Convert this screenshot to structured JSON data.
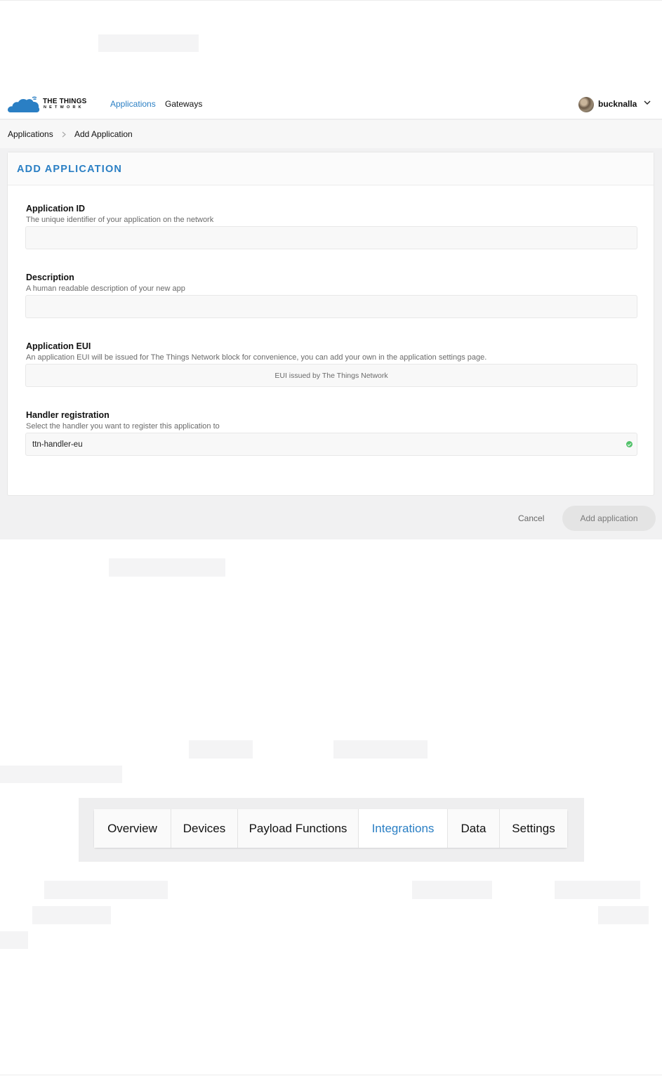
{
  "topbar": {
    "logo_title": "THE THINGS",
    "logo_subtitle": "NETWORK",
    "nav": [
      {
        "label": "Applications",
        "active": true
      },
      {
        "label": "Gateways",
        "active": false
      }
    ],
    "username": "bucknalla"
  },
  "breadcrumb": {
    "items": [
      "Applications",
      "Add Application"
    ]
  },
  "form": {
    "title": "ADD APPLICATION",
    "fields": [
      {
        "label": "Application ID",
        "description": "The unique identifier of your application on the network",
        "value": "",
        "placeholder": ""
      },
      {
        "label": "Description",
        "description": "A human readable description of your new app",
        "value": "",
        "placeholder": ""
      },
      {
        "label": "Application EUI",
        "description": "An application EUI will be issued for The Things Network block for convenience, you can add your own in the application settings page.",
        "value": "",
        "placeholder": "EUI issued by The Things Network"
      },
      {
        "label": "Handler registration",
        "description": "Select the handler you want to register this application to",
        "value": "ttn-handler-eu",
        "placeholder": ""
      }
    ],
    "cancel_label": "Cancel",
    "submit_label": "Add application"
  },
  "tabs": [
    {
      "label": "Overview",
      "active": false
    },
    {
      "label": "Devices",
      "active": false
    },
    {
      "label": "Payload Functions",
      "active": false
    },
    {
      "label": "Integrations",
      "active": true
    },
    {
      "label": "Data",
      "active": false
    },
    {
      "label": "Settings",
      "active": false
    }
  ],
  "colors": {
    "accent": "#2a7fc4",
    "success": "#53c26b",
    "panel_bg": "#f1f1f2"
  },
  "icons": [
    "ttn-cloud-logo-icon",
    "chevron-down-icon",
    "chevron-right-icon",
    "check-circle-icon"
  ]
}
